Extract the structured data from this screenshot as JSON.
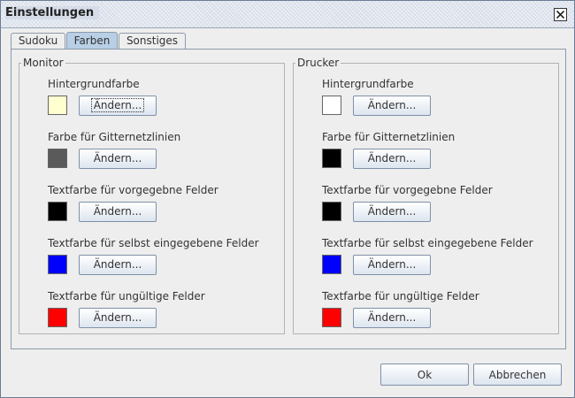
{
  "window": {
    "title": "Einstellungen"
  },
  "tabs": [
    {
      "label": "Sudoku",
      "active": false
    },
    {
      "label": "Farben",
      "active": true
    },
    {
      "label": "Sonstiges",
      "active": false
    }
  ],
  "monitor": {
    "legend": "Monitor",
    "rows": [
      {
        "label": "Hintergrundfarbe",
        "color": "#ffffd0",
        "button": "Ändern..."
      },
      {
        "label": "Farbe für Gitternetzlinien",
        "color": "#5a5a5a",
        "button": "Ändern..."
      },
      {
        "label": "Textfarbe für vorgegebne Felder",
        "color": "#000000",
        "button": "Ändern..."
      },
      {
        "label": "Textfarbe für selbst eingegebene Felder",
        "color": "#0000ff",
        "button": "Ändern..."
      },
      {
        "label": "Textfarbe für ungültige Felder",
        "color": "#ff0000",
        "button": "Ändern..."
      }
    ]
  },
  "printer": {
    "legend": "Drucker",
    "rows": [
      {
        "label": "Hintergrundfarbe",
        "color": "#ffffff",
        "button": "Ändern..."
      },
      {
        "label": "Farbe für Gitternetzlinien",
        "color": "#000000",
        "button": "Ändern..."
      },
      {
        "label": "Textfarbe für vorgegebne Felder",
        "color": "#000000",
        "button": "Ändern..."
      },
      {
        "label": "Textfarbe für selbst eingegebene Felder",
        "color": "#0000ff",
        "button": "Ändern..."
      },
      {
        "label": "Textfarbe für ungültige Felder",
        "color": "#ff0000",
        "button": "Ändern..."
      }
    ]
  },
  "footer": {
    "ok_label": "Ok",
    "cancel_label": "Abbrechen"
  }
}
